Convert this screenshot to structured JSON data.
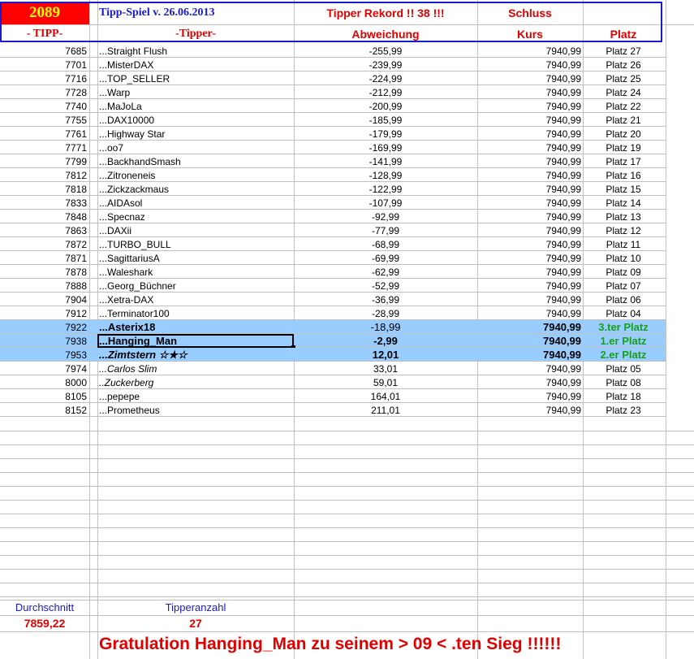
{
  "header": {
    "count": "2089",
    "title": "Tipp-Spiel v. 26.06.2013",
    "record": "Tipper Rekord !!  38  !!!",
    "schluss": "Schluss",
    "col_tipp": "- TIPP-",
    "col_tipper": "-Tipper-",
    "col_abweichung": "Abweichung",
    "col_kurs": "Kurs",
    "col_platz": "Platz"
  },
  "rows": [
    {
      "tipp": "7685",
      "name": "...Straight Flush",
      "abw": "-255,99",
      "kurs": "7940,99",
      "platz": "Platz 27"
    },
    {
      "tipp": "7701",
      "name": "...MisterDAX",
      "abw": "-239,99",
      "kurs": "7940,99",
      "platz": "Platz 26"
    },
    {
      "tipp": "7716",
      "name": "...TOP_SELLER",
      "abw": "-224,99",
      "kurs": "7940,99",
      "platz": "Platz 25"
    },
    {
      "tipp": "7728",
      "name": "...Warp",
      "abw": "-212,99",
      "kurs": "7940,99",
      "platz": "Platz 24"
    },
    {
      "tipp": "7740",
      "name": "...MaJoLa",
      "abw": "-200,99",
      "kurs": "7940,99",
      "platz": "Platz 22"
    },
    {
      "tipp": "7755",
      "name": "...DAX10000",
      "abw": "-185,99",
      "kurs": "7940,99",
      "platz": "Platz 21"
    },
    {
      "tipp": "7761",
      "name": "...Highway Star",
      "abw": "-179,99",
      "kurs": "7940,99",
      "platz": "Platz 20"
    },
    {
      "tipp": "7771",
      "name": "...oo7",
      "abw": "-169,99",
      "kurs": "7940,99",
      "platz": "Platz 19"
    },
    {
      "tipp": "7799",
      "name": "...BackhandSmash",
      "abw": "-141,99",
      "kurs": "7940,99",
      "platz": "Platz 17"
    },
    {
      "tipp": "7812",
      "name": "...Zitroneneis",
      "abw": "-128,99",
      "kurs": "7940,99",
      "platz": "Platz 16"
    },
    {
      "tipp": "7818",
      "name": "...Zickzackmaus",
      "abw": "-122,99",
      "kurs": "7940,99",
      "platz": "Platz 15"
    },
    {
      "tipp": "7833",
      "name": "...AIDAsol",
      "abw": "-107,99",
      "kurs": "7940,99",
      "platz": "Platz 14"
    },
    {
      "tipp": "7848",
      "name": "...Specnaz",
      "abw": "-92,99",
      "kurs": "7940,99",
      "platz": "Platz 13"
    },
    {
      "tipp": "7863",
      "name": "...DAXii",
      "abw": "-77,99",
      "kurs": "7940,99",
      "platz": "Platz 12"
    },
    {
      "tipp": "7872",
      "name": "...TURBO_BULL",
      "abw": "-68,99",
      "kurs": "7940,99",
      "platz": "Platz 11"
    },
    {
      "tipp": "7871",
      "name": "...SagittariusA",
      "abw": "-69,99",
      "kurs": "7940,99",
      "platz": "Platz 10"
    },
    {
      "tipp": "7878",
      "name": "...Waleshark",
      "abw": "-62,99",
      "kurs": "7940,99",
      "platz": "Platz 09"
    },
    {
      "tipp": "7888",
      "name": "...Georg_Büchner",
      "abw": "-52,99",
      "kurs": "7940,99",
      "platz": "Platz 07"
    },
    {
      "tipp": "7904",
      "name": "...Xetra-DAX",
      "abw": "-36,99",
      "kurs": "7940,99",
      "platz": "Platz 06"
    },
    {
      "tipp": "7912",
      "name": "...Terminator100",
      "abw": "-28,99",
      "kurs": "7940,99",
      "platz": "Platz 04"
    },
    {
      "tipp": "7922",
      "name": "...Asterix18",
      "abw": "-18,99",
      "kurs": "7940,99",
      "platz": "3.ter Platz",
      "hi": true
    },
    {
      "tipp": "7938",
      "name": "...Hanging_Man",
      "abw": "-2,99",
      "kurs": "7940,99",
      "platz": "1.er Platz",
      "hi": true,
      "sel": true
    },
    {
      "tipp": "7953",
      "name": "...Zimtstern ☆★☆",
      "abw": "12,01",
      "kurs": "7940,99",
      "platz": "2.er Platz",
      "hi": true,
      "it": true
    },
    {
      "tipp": "7974",
      "name": "...Carlos Slim",
      "abw": "33,01",
      "kurs": "7940,99",
      "platz": "Platz 05",
      "it": true
    },
    {
      "tipp": "8000",
      "name": "..Zuckerberg",
      "abw": "59,01",
      "kurs": "7940,99",
      "platz": "Platz 08",
      "it": true
    },
    {
      "tipp": "8105",
      "name": "...pepepe",
      "abw": "164,01",
      "kurs": "7940,99",
      "platz": "Platz 18"
    },
    {
      "tipp": "8152",
      "name": "...Prometheus",
      "abw": "211,01",
      "kurs": "7940,99",
      "platz": "Platz 23"
    }
  ],
  "footer": {
    "avg_label": "Durchschnitt",
    "avg_value": "7859,22",
    "count_label": "Tipperanzahl",
    "count_value": "27",
    "congrats": "Gratulation Hanging_Man zu seinem > 09 < .ten Sieg !!!!!!"
  },
  "colors": {
    "highlight": "#99ccff",
    "red": "#e00000",
    "green": "#18a018",
    "blue": "#1a1ad0"
  }
}
